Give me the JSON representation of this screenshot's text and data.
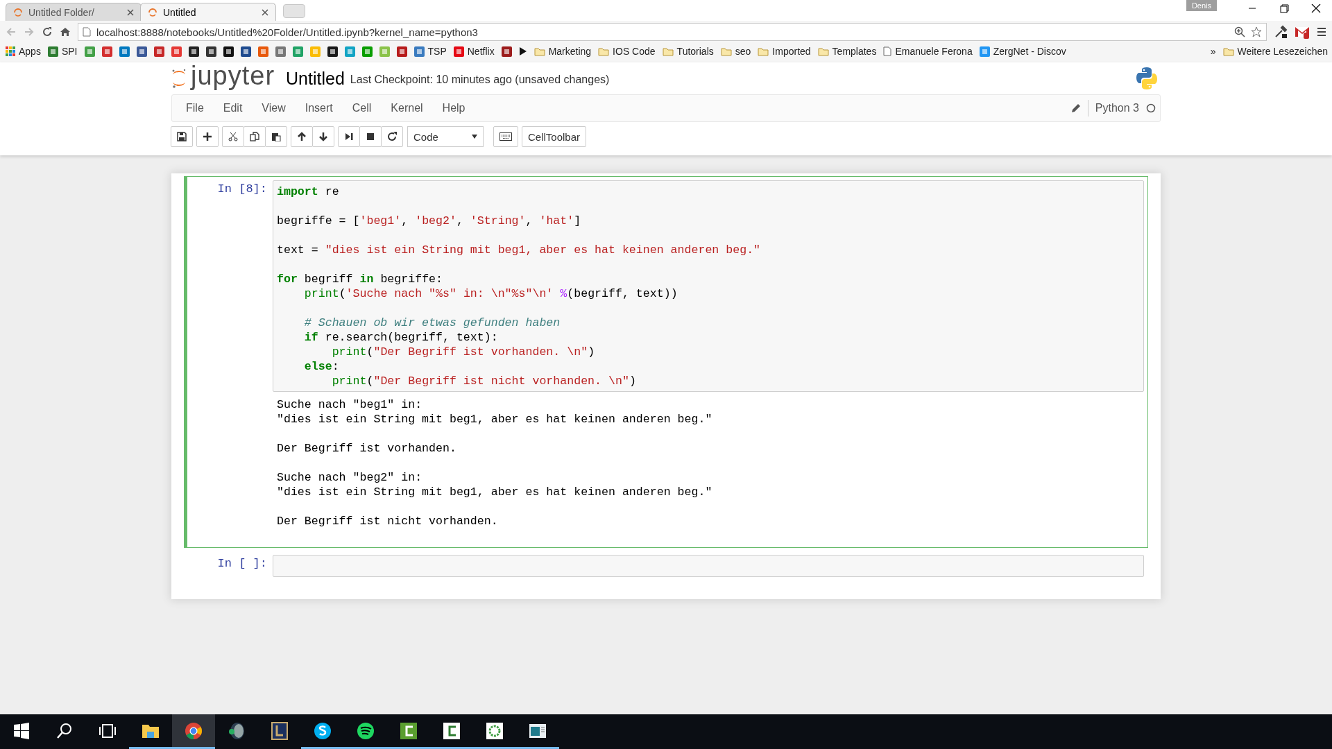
{
  "browser": {
    "tabs": [
      {
        "title": "Untitled Folder/",
        "selected": false
      },
      {
        "title": "Untitled",
        "selected": true
      }
    ],
    "profile": "Denis",
    "url": "localhost:8888/notebooks/Untitled%20Folder/Untitled.ipynb?kernel_name=python3",
    "bookmarks": [
      {
        "kind": "apps",
        "label": "Apps"
      },
      {
        "kind": "site",
        "color": "#2e7d32",
        "label": "SPI"
      },
      {
        "kind": "site",
        "color": "#43a047"
      },
      {
        "kind": "site",
        "color": "#d32f2f"
      },
      {
        "kind": "site",
        "color": "#0079bf"
      },
      {
        "kind": "site",
        "color": "#3b5998"
      },
      {
        "kind": "site",
        "color": "#c62828"
      },
      {
        "kind": "site",
        "color": "#e53935"
      },
      {
        "kind": "site",
        "color": "#222222"
      },
      {
        "kind": "site",
        "color": "#333333"
      },
      {
        "kind": "site",
        "color": "#111111"
      },
      {
        "kind": "site",
        "color": "#1e4b8f"
      },
      {
        "kind": "site",
        "color": "#e8590c"
      },
      {
        "kind": "site",
        "color": "#777777"
      },
      {
        "kind": "site",
        "color": "#21a366"
      },
      {
        "kind": "site",
        "color": "#fbbc05"
      },
      {
        "kind": "site",
        "color": "#1a1a1a"
      },
      {
        "kind": "site",
        "color": "#12a4c4"
      },
      {
        "kind": "site",
        "color": "#0a9e01"
      },
      {
        "kind": "site",
        "color": "#8bc34a"
      },
      {
        "kind": "site",
        "color": "#b71c1c"
      },
      {
        "kind": "site",
        "color": "#3a7bbf",
        "label": "TSP"
      },
      {
        "kind": "site",
        "color": "#e50914",
        "label": "Netflix"
      },
      {
        "kind": "site",
        "color": "#9c1c1c"
      },
      {
        "kind": "play"
      },
      {
        "kind": "folder",
        "label": "Marketing"
      },
      {
        "kind": "folder",
        "label": "IOS Code"
      },
      {
        "kind": "folder",
        "label": "Tutorials"
      },
      {
        "kind": "folder",
        "label": "seo"
      },
      {
        "kind": "folder",
        "label": "Imported"
      },
      {
        "kind": "folder",
        "label": "Templates"
      },
      {
        "kind": "page",
        "label": "Emanuele Ferona"
      },
      {
        "kind": "site",
        "color": "#2196f3",
        "label": "ZergNet - Discov"
      }
    ],
    "more": "»",
    "other_bookmarks": "Weitere Lesezeichen"
  },
  "notebook": {
    "logo_text": "jupyter",
    "title": "Untitled",
    "checkpoint": "Last Checkpoint: 10 minutes ago (unsaved changes)",
    "menu": [
      "File",
      "Edit",
      "View",
      "Insert",
      "Cell",
      "Kernel",
      "Help"
    ],
    "kernel": "Python 3",
    "cell_type": "Code",
    "celltoolbar": "CellToolbar",
    "cells": [
      {
        "prompt": "In [8]:",
        "selected": true,
        "code": [
          [
            [
              {
                "t": "import",
                "kind": "keyword"
              },
              {
                "t": " re",
                "kind": "plain"
              }
            ]
          ],
          [
            [
              {
                "t": "begriffe = [",
                "kind": "plain"
              },
              {
                "t": "'beg1'",
                "kind": "string"
              },
              {
                "t": ", ",
                "kind": "plain"
              },
              {
                "t": "'beg2'",
                "kind": "string"
              },
              {
                "t": ", ",
                "kind": "plain"
              },
              {
                "t": "'String'",
                "kind": "string"
              },
              {
                "t": ", ",
                "kind": "plain"
              },
              {
                "t": "'hat'",
                "kind": "string"
              },
              {
                "t": "]",
                "kind": "plain"
              }
            ]
          ],
          [
            [
              {
                "t": "text = ",
                "kind": "plain"
              },
              {
                "t": "\"dies ist ein String mit beg1, aber es hat keinen anderen beg.\"",
                "kind": "string"
              }
            ]
          ],
          [
            [
              {
                "t": "for",
                "kind": "keyword"
              },
              {
                "t": " begriff ",
                "kind": "plain"
              },
              {
                "t": "in",
                "kind": "keyword"
              },
              {
                "t": " begriffe:",
                "kind": "plain"
              }
            ],
            [
              {
                "t": "    print",
                "kind": "builtin"
              },
              {
                "t": "(",
                "kind": "plain"
              },
              {
                "t": "'Suche nach \"%s\" in: \\n\"%s\"\\n'",
                "kind": "string"
              },
              {
                "t": " %",
                "kind": "operator"
              },
              {
                "t": "(begriff, text))",
                "kind": "plain"
              }
            ]
          ],
          [
            [
              {
                "t": "    # Schauen ob wir etwas gefunden haben",
                "kind": "comment"
              }
            ],
            [
              {
                "t": "    if",
                "kind": "keyword"
              },
              {
                "t": " re.search(begriff, text):",
                "kind": "plain"
              }
            ],
            [
              {
                "t": "        print",
                "kind": "builtin"
              },
              {
                "t": "(",
                "kind": "plain"
              },
              {
                "t": "\"Der Begriff ist vorhanden. \\n\"",
                "kind": "string"
              },
              {
                "t": ")",
                "kind": "plain"
              }
            ],
            [
              {
                "t": "    else",
                "kind": "keyword"
              },
              {
                "t": ":",
                "kind": "plain"
              }
            ],
            [
              {
                "t": "        print",
                "kind": "builtin"
              },
              {
                "t": "(",
                "kind": "plain"
              },
              {
                "t": "\"Der Begriff ist nicht vorhanden. \\n\"",
                "kind": "string"
              },
              {
                "t": ")",
                "kind": "plain"
              }
            ]
          ]
        ],
        "output": [
          [
            "Suche nach \"beg1\" in:",
            "\"dies ist ein String mit beg1, aber es hat keinen anderen beg.\""
          ],
          [
            "Der Begriff ist vorhanden."
          ],
          [
            "Suche nach \"beg2\" in:",
            "\"dies ist ein String mit beg1, aber es hat keinen anderen beg.\""
          ],
          [
            "Der Begriff ist nicht vorhanden."
          ]
        ]
      },
      {
        "prompt": "In [ ]:",
        "selected": false
      }
    ]
  },
  "taskbar": {
    "apps": [
      {
        "kind": "explorer",
        "running": true,
        "selected": false
      },
      {
        "kind": "chrome",
        "running": true,
        "selected": true
      },
      {
        "kind": "headset",
        "running": false,
        "selected": false
      },
      {
        "kind": "game",
        "running": false,
        "selected": false
      },
      {
        "kind": "skype",
        "running": true,
        "selected": false
      },
      {
        "kind": "spotify",
        "running": true,
        "selected": false
      },
      {
        "kind": "camtasia",
        "running": true,
        "selected": false
      },
      {
        "kind": "recorder",
        "running": true,
        "selected": false
      },
      {
        "kind": "ring",
        "running": true,
        "selected": false
      },
      {
        "kind": "window",
        "running": true,
        "selected": false
      }
    ]
  }
}
